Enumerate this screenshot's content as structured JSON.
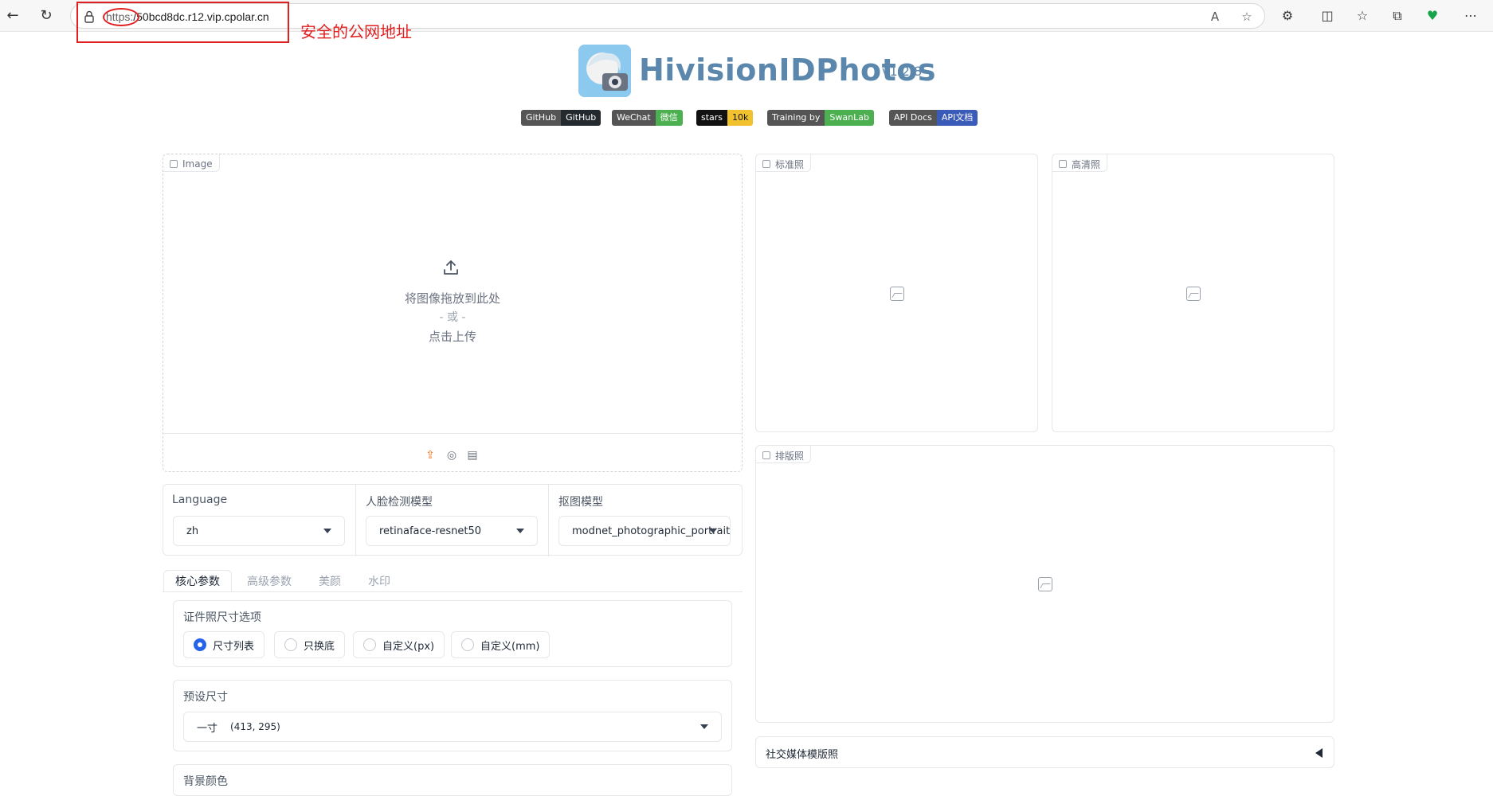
{
  "browser": {
    "url_scheme": "https:",
    "url_rest": "/50bcd8dc.r12.vip.cpolar.cn",
    "annotation": "安全的公网地址"
  },
  "header": {
    "title": "HivisionIDPhotos",
    "version": "v1.2.8"
  },
  "badges": [
    {
      "left": "GitHub",
      "right": "GitHub",
      "color": "#24292e"
    },
    {
      "left": "WeChat",
      "right": "微信",
      "color": "#4caf50"
    },
    {
      "left": "stars",
      "right": "10k",
      "color": "#f2c12e"
    },
    {
      "left": "Training by",
      "right": "SwanLab",
      "color": "#4caf50"
    },
    {
      "left": "API Docs",
      "right": "API文档",
      "color": "#3b5bb8"
    }
  ],
  "upload": {
    "label": "Image",
    "line1": "将图像拖放到此处",
    "line2": "- 或 -",
    "line3": "点击上传"
  },
  "outputs": {
    "standard": "标准照",
    "hd": "高清照",
    "layout": "排版照",
    "social": "社交媒体模版照"
  },
  "settings": {
    "language_label": "Language",
    "language_value": "zh",
    "face_model_label": "人脸检测模型",
    "face_model_value": "retinaface-resnet50",
    "matting_model_label": "抠图模型",
    "matting_model_value": "modnet_photographic_portrait"
  },
  "tabs": [
    "核心参数",
    "高级参数",
    "美颜",
    "水印"
  ],
  "size_options": {
    "label": "证件照尺寸选项",
    "options": [
      "尺寸列表",
      "只换底",
      "自定义(px)",
      "自定义(mm)"
    ],
    "selected": "尺寸列表"
  },
  "preset": {
    "label": "预设尺寸",
    "value": "一寸",
    "value_dims": "(413, 295)"
  },
  "background": {
    "label": "背景颜色"
  }
}
